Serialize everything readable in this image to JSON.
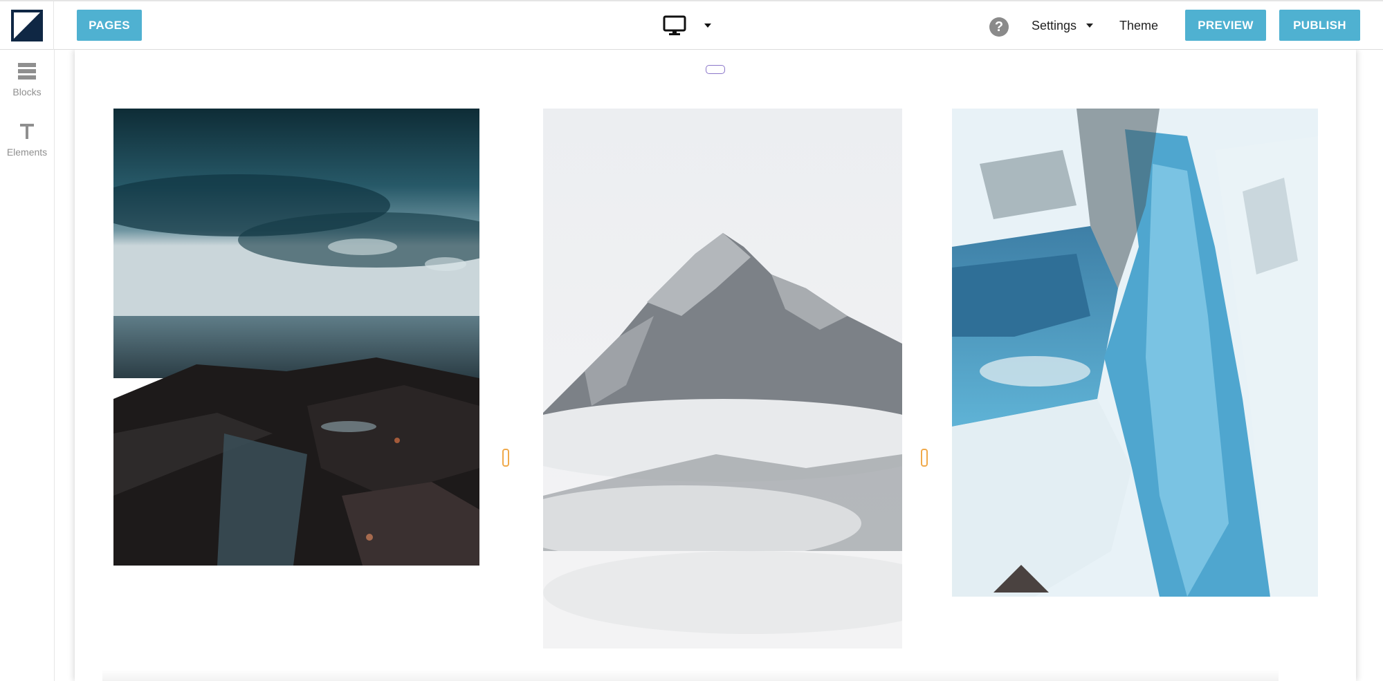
{
  "toolbar": {
    "pages_label": "PAGES",
    "settings_label": "Settings",
    "theme_label": "Theme",
    "preview_label": "PREVIEW",
    "publish_label": "PUBLISH",
    "help_glyph": "?",
    "device_icon": "desktop-monitor-icon"
  },
  "sidebar": {
    "items": [
      {
        "label": "Blocks",
        "icon": "blocks-icon"
      },
      {
        "label": "Elements",
        "icon": "text-t-icon"
      }
    ]
  },
  "canvas": {
    "gallery": [
      {
        "subject": "dark stormy sky over rocky shoreline",
        "icon": "photo"
      },
      {
        "subject": "snowy mountain peak above clouds",
        "icon": "photo"
      },
      {
        "subject": "icy waterfall canyon",
        "icon": "photo"
      }
    ]
  },
  "colors": {
    "accent": "#4fb1d1",
    "logo": "#0f2744",
    "handle": "#f0a94a",
    "block_pill": "#8a75c9"
  }
}
